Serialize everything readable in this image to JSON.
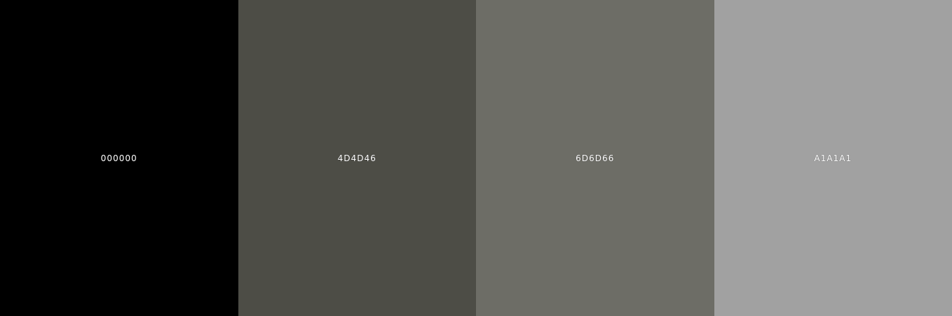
{
  "palette": {
    "swatches": [
      {
        "label": "000000",
        "color": "#000000"
      },
      {
        "label": "4D4D46",
        "color": "#4D4D46"
      },
      {
        "label": "6D6D66",
        "color": "#6D6D66"
      },
      {
        "label": "A1A1A1",
        "color": "#A1A1A1"
      }
    ]
  }
}
